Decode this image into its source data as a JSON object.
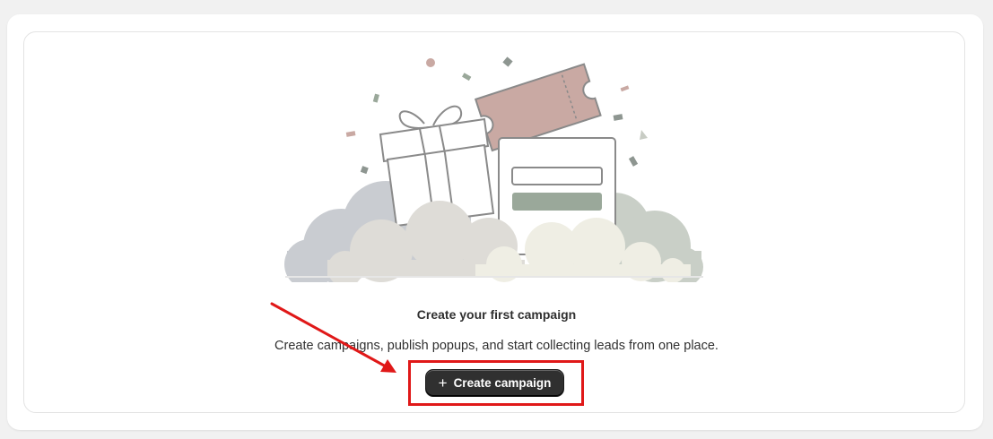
{
  "empty_state": {
    "title": "Create your first campaign",
    "description": "Create campaigns, publish popups, and start collecting leads from one place.",
    "primary_action": {
      "icon": "plus-icon",
      "icon_glyph": "+",
      "label": "Create campaign"
    }
  },
  "annotation": {
    "color": "#e01818"
  },
  "colors": {
    "button_bg": "#303030",
    "ticket": "#c9a9a3",
    "form_button": "#9aa89a"
  }
}
